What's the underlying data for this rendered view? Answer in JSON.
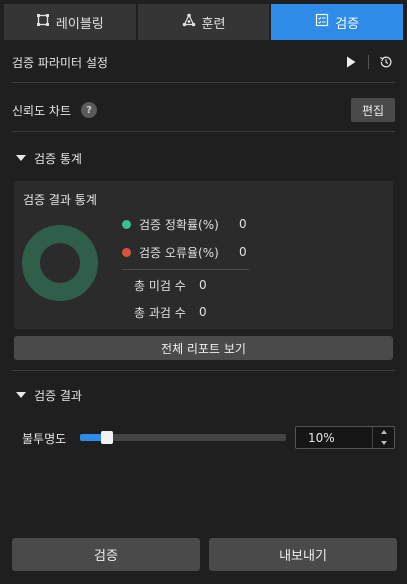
{
  "tabs": [
    {
      "label": "레이블링",
      "icon": "labeling-frame-icon",
      "active": false
    },
    {
      "label": "훈련",
      "icon": "network-nodes-icon",
      "active": false
    },
    {
      "label": "검증",
      "icon": "checklist-icon",
      "active": true
    }
  ],
  "params": {
    "title": "검증 파라미터 설정",
    "run_icon": "play-icon",
    "history_icon": "history-icon"
  },
  "confidence": {
    "label": "신뢰도 차트",
    "help": "?",
    "edit_label": "편집"
  },
  "stats_section": {
    "title": "검증 통계",
    "box_title": "검증 결과 통계",
    "accuracy_label": "검증 정확률(%)",
    "accuracy_value": "0",
    "error_label": "검증 오류율(%)",
    "error_value": "0",
    "missed_label": "총 미검 수",
    "missed_value": "0",
    "over_label": "총 과검 수",
    "over_value": "0",
    "report_button": "전체 리포트 보기"
  },
  "results_section": {
    "title": "검증 결과",
    "opacity_label": "불투명도",
    "opacity_value": "10%",
    "opacity_fraction": 0.1
  },
  "bottom": {
    "validate_button": "검증",
    "export_button": "내보내기"
  },
  "colors": {
    "accent": "#2e8be8",
    "accuracy_dot": "#3bbf8c",
    "error_dot": "#d9533c",
    "donut": "#2f5e4b"
  }
}
